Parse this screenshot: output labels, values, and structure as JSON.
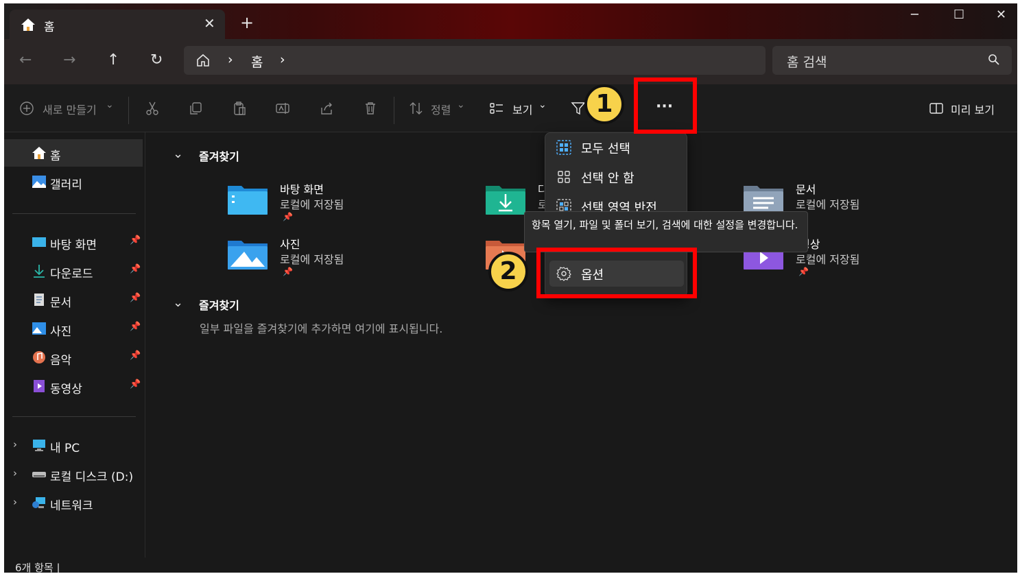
{
  "window": {
    "tab_title": "홈",
    "new_tab": "+",
    "minimize": "─",
    "maximize": "☐",
    "close": "✕",
    "tab_close": "✕"
  },
  "nav": {
    "back": "←",
    "forward": "→",
    "up": "↑",
    "refresh": "↻",
    "breadcrumb": [
      "홈"
    ],
    "sep": "›",
    "search_placeholder": "홈 검색"
  },
  "toolbar": {
    "new_label": "새로 만들기",
    "sort_label": "정렬",
    "view_label": "보기",
    "more_label": "···",
    "preview_label": "미리 보기",
    "dropdown_caret": "⌄"
  },
  "sidebar": {
    "top": [
      {
        "label": "홈",
        "icon": "home-icon",
        "active": true
      },
      {
        "label": "갤러리",
        "icon": "gallery-icon"
      }
    ],
    "pinned": [
      {
        "label": "바탕 화면",
        "icon": "desktop-icon"
      },
      {
        "label": "다운로드",
        "icon": "download-icon"
      },
      {
        "label": "문서",
        "icon": "document-icon"
      },
      {
        "label": "사진",
        "icon": "pictures-icon"
      },
      {
        "label": "음악",
        "icon": "music-icon"
      },
      {
        "label": "동영상",
        "icon": "video-icon"
      }
    ],
    "pin_glyph": "📌",
    "drives": [
      {
        "label": "내 PC",
        "icon": "pc-icon"
      },
      {
        "label": "로컬 디스크 (D:)",
        "icon": "drive-icon"
      },
      {
        "label": "네트워크",
        "icon": "network-icon"
      }
    ],
    "chevron": "›"
  },
  "main": {
    "section_quick": "즐겨찾기",
    "section_favorites": "즐겨찾기",
    "favorites_hint": "일부 파일을 즐겨찾기에 추가하면 여기에 표시됩니다.",
    "folders": [
      {
        "name": "바탕 화면",
        "sub": "로컬에 저장됨",
        "icon": "desktop-folder-icon"
      },
      {
        "name": "다",
        "sub": "로",
        "icon": "download-folder-icon"
      },
      {
        "name": "문서",
        "sub": "로컬에 저장됨",
        "icon": "document-folder-icon"
      },
      {
        "name": "사진",
        "sub": "로컬에 저장됨",
        "icon": "pictures-folder-icon"
      },
      {
        "name": "",
        "sub": "",
        "icon": "music-folder-icon"
      },
      {
        "name": "영상",
        "sub": "로컬에 저장됨",
        "icon": "video-folder-icon"
      }
    ],
    "chevron_down": "⌄"
  },
  "menu": {
    "items": [
      {
        "label": "모두 선택",
        "icon": "select-all-icon"
      },
      {
        "label": "선택 안 함",
        "icon": "select-none-icon"
      },
      {
        "label": "선택 영역 반전",
        "icon": "invert-selection-icon"
      },
      {
        "label": "옵션",
        "icon": "gear-icon"
      }
    ],
    "tooltip": "항목 열기, 파일 및 폴더 보기, 검색에 대한 설정을 변경합니다."
  },
  "annotations": {
    "badge1": "1",
    "badge2": "2",
    "color": "#ff0000",
    "badge_color": "#f7d24b"
  },
  "status": {
    "count": "6개 항목 |"
  }
}
